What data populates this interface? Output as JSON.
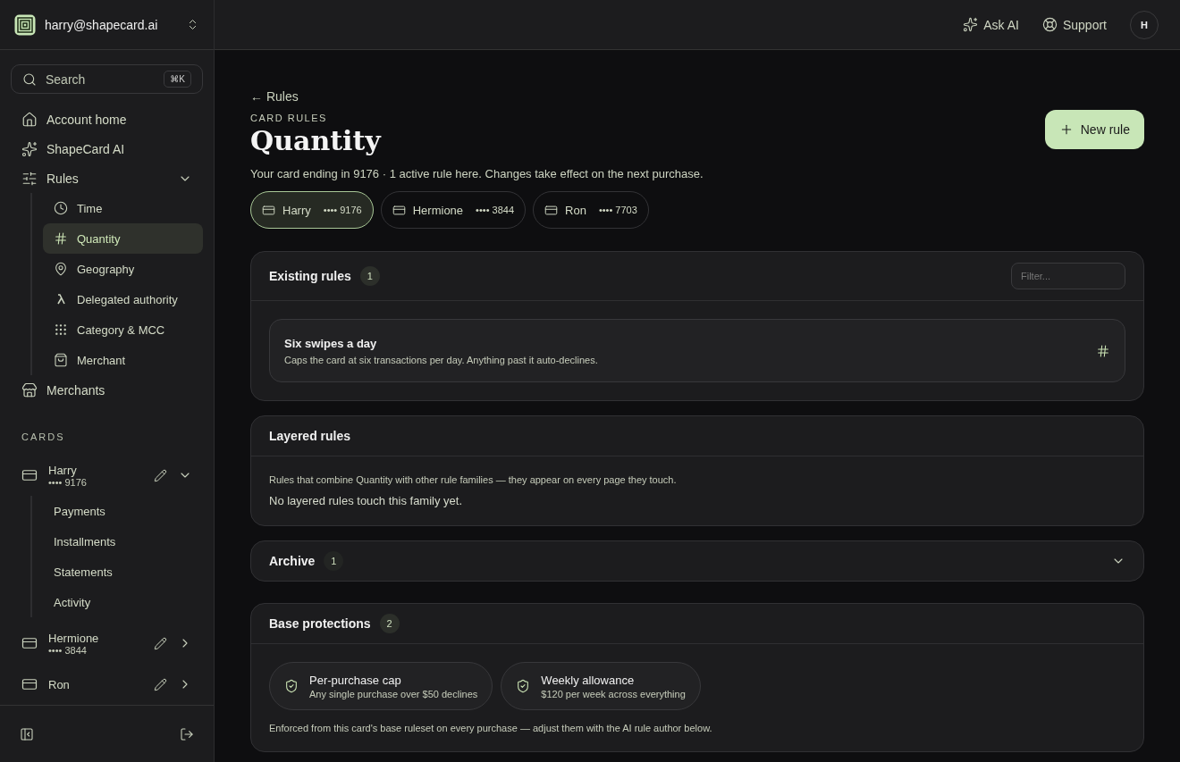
{
  "account": {
    "email": "harry@shapecard.ai"
  },
  "search": {
    "placeholder": "Search",
    "shortcut": "⌘K"
  },
  "nav": [
    {
      "label": "Account home",
      "selected": false
    },
    {
      "label": "ShapeCard AI",
      "selected": false
    },
    {
      "label": "Rules",
      "selected": false,
      "expanded": true,
      "children": [
        {
          "label": "Time",
          "selected": false
        },
        {
          "label": "Quantity",
          "selected": true
        },
        {
          "label": "Geography",
          "selected": false
        },
        {
          "label": "Delegated authority",
          "selected": false
        },
        {
          "label": "Category & MCC",
          "selected": false
        },
        {
          "label": "Merchant",
          "selected": false
        }
      ]
    },
    {
      "label": "Merchants",
      "selected": false
    }
  ],
  "cards_heading": "CARDS",
  "cards": [
    {
      "name": "Harry",
      "number": "•••• 9176",
      "expanded": true,
      "children": [
        {
          "label": "Payments"
        },
        {
          "label": "Installments"
        },
        {
          "label": "Statements"
        },
        {
          "label": "Activity"
        }
      ]
    },
    {
      "name": "Hermione",
      "number": "•••• 3844",
      "expanded": false
    },
    {
      "name": "Ron",
      "expanded": false
    }
  ],
  "topbar": {
    "ask_ai": "Ask AI",
    "support": "Support",
    "avatar": "H"
  },
  "breadcrumb": "← Rules",
  "eyebrow": "CARD RULES",
  "title": "Quantity",
  "new_rule": "New rule",
  "subtitle": "Your card ending in 9176 · 1 active rule here. Changes take effect on the next purchase.",
  "card_tabs": [
    {
      "name": "Harry",
      "number": "•••• 9176",
      "selected": true
    },
    {
      "name": "Hermione",
      "number": "•••• 3844",
      "selected": false
    },
    {
      "name": "Ron",
      "number": "•••• 7703",
      "selected": false
    }
  ],
  "existing_rules": {
    "title": "Existing rules",
    "count": "1",
    "filter_placeholder": "Filter...",
    "rules": [
      {
        "name": "Six swipes a day",
        "description": "Caps the card at six transactions per day. Anything past it auto-declines."
      }
    ]
  },
  "layered_rules": {
    "title": "Layered rules",
    "note": "Rules that combine Quantity with other rule families — they appear on every page they touch.",
    "empty": "No layered rules touch this family yet."
  },
  "archive": {
    "title": "Archive",
    "count": "1",
    "expanded": false
  },
  "base_protections": {
    "title": "Base protections",
    "count": "2",
    "items": [
      {
        "name": "Per-purchase cap",
        "description": "Any single purchase over $50 declines"
      },
      {
        "name": "Weekly allowance",
        "description": "$120 per week across everything"
      }
    ],
    "note": "Enforced from this card's base ruleset on every purchase — adjust them with the AI rule author below."
  }
}
